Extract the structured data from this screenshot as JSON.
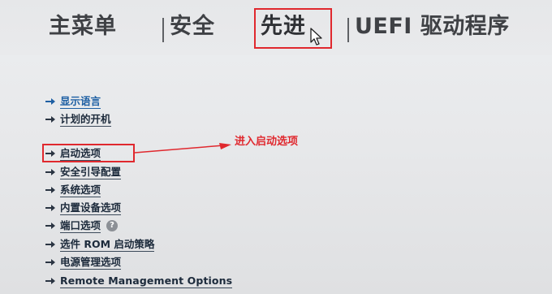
{
  "tabs": [
    {
      "label": "主菜单",
      "active": false
    },
    {
      "label": "安全",
      "active": false
    },
    {
      "label": "先进",
      "active": true
    },
    {
      "label": "UEFI 驱动程序",
      "active": false
    }
  ],
  "menu_items": [
    {
      "label": "显示语言",
      "style": "link"
    },
    {
      "label": "计划的开机",
      "style": "normal"
    },
    {
      "label": "启动选项",
      "style": "normal",
      "highlighted": true
    },
    {
      "label": "安全引导配置",
      "style": "normal"
    },
    {
      "label": "系统选项",
      "style": "normal"
    },
    {
      "label": "内置设备选项",
      "style": "normal"
    },
    {
      "label": "端口选项",
      "style": "normal",
      "help": "?"
    },
    {
      "label": "选件 ROM 启动策略",
      "style": "normal"
    },
    {
      "label": "电源管理选项",
      "style": "normal"
    },
    {
      "label": "Remote Management Options",
      "style": "normal"
    }
  ],
  "annotation": {
    "text": "进入启动选项",
    "color": "#e0282e"
  },
  "colors": {
    "link": "#1d5fa3",
    "text": "#1c2a3b",
    "tab_text": "#3f4145",
    "highlight": "#e0282e",
    "background": "#e9eaec"
  }
}
